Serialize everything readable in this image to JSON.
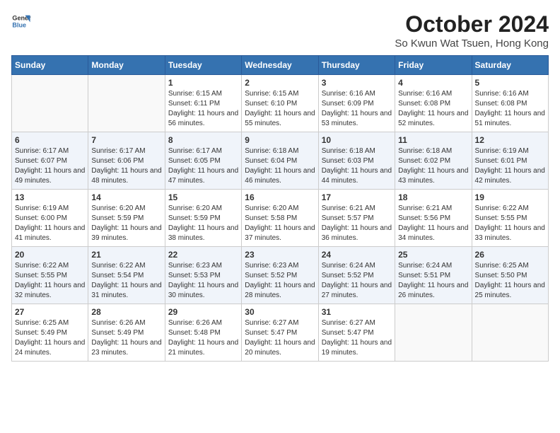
{
  "header": {
    "logo_line1": "General",
    "logo_line2": "Blue",
    "title": "October 2024",
    "subtitle": "So Kwun Wat Tsuen, Hong Kong"
  },
  "days_of_week": [
    "Sunday",
    "Monday",
    "Tuesday",
    "Wednesday",
    "Thursday",
    "Friday",
    "Saturday"
  ],
  "weeks": [
    [
      {
        "num": "",
        "detail": ""
      },
      {
        "num": "",
        "detail": ""
      },
      {
        "num": "1",
        "detail": "Sunrise: 6:15 AM\nSunset: 6:11 PM\nDaylight: 11 hours and 56 minutes."
      },
      {
        "num": "2",
        "detail": "Sunrise: 6:15 AM\nSunset: 6:10 PM\nDaylight: 11 hours and 55 minutes."
      },
      {
        "num": "3",
        "detail": "Sunrise: 6:16 AM\nSunset: 6:09 PM\nDaylight: 11 hours and 53 minutes."
      },
      {
        "num": "4",
        "detail": "Sunrise: 6:16 AM\nSunset: 6:08 PM\nDaylight: 11 hours and 52 minutes."
      },
      {
        "num": "5",
        "detail": "Sunrise: 6:16 AM\nSunset: 6:08 PM\nDaylight: 11 hours and 51 minutes."
      }
    ],
    [
      {
        "num": "6",
        "detail": "Sunrise: 6:17 AM\nSunset: 6:07 PM\nDaylight: 11 hours and 49 minutes."
      },
      {
        "num": "7",
        "detail": "Sunrise: 6:17 AM\nSunset: 6:06 PM\nDaylight: 11 hours and 48 minutes."
      },
      {
        "num": "8",
        "detail": "Sunrise: 6:17 AM\nSunset: 6:05 PM\nDaylight: 11 hours and 47 minutes."
      },
      {
        "num": "9",
        "detail": "Sunrise: 6:18 AM\nSunset: 6:04 PM\nDaylight: 11 hours and 46 minutes."
      },
      {
        "num": "10",
        "detail": "Sunrise: 6:18 AM\nSunset: 6:03 PM\nDaylight: 11 hours and 44 minutes."
      },
      {
        "num": "11",
        "detail": "Sunrise: 6:18 AM\nSunset: 6:02 PM\nDaylight: 11 hours and 43 minutes."
      },
      {
        "num": "12",
        "detail": "Sunrise: 6:19 AM\nSunset: 6:01 PM\nDaylight: 11 hours and 42 minutes."
      }
    ],
    [
      {
        "num": "13",
        "detail": "Sunrise: 6:19 AM\nSunset: 6:00 PM\nDaylight: 11 hours and 41 minutes."
      },
      {
        "num": "14",
        "detail": "Sunrise: 6:20 AM\nSunset: 5:59 PM\nDaylight: 11 hours and 39 minutes."
      },
      {
        "num": "15",
        "detail": "Sunrise: 6:20 AM\nSunset: 5:59 PM\nDaylight: 11 hours and 38 minutes."
      },
      {
        "num": "16",
        "detail": "Sunrise: 6:20 AM\nSunset: 5:58 PM\nDaylight: 11 hours and 37 minutes."
      },
      {
        "num": "17",
        "detail": "Sunrise: 6:21 AM\nSunset: 5:57 PM\nDaylight: 11 hours and 36 minutes."
      },
      {
        "num": "18",
        "detail": "Sunrise: 6:21 AM\nSunset: 5:56 PM\nDaylight: 11 hours and 34 minutes."
      },
      {
        "num": "19",
        "detail": "Sunrise: 6:22 AM\nSunset: 5:55 PM\nDaylight: 11 hours and 33 minutes."
      }
    ],
    [
      {
        "num": "20",
        "detail": "Sunrise: 6:22 AM\nSunset: 5:55 PM\nDaylight: 11 hours and 32 minutes."
      },
      {
        "num": "21",
        "detail": "Sunrise: 6:22 AM\nSunset: 5:54 PM\nDaylight: 11 hours and 31 minutes."
      },
      {
        "num": "22",
        "detail": "Sunrise: 6:23 AM\nSunset: 5:53 PM\nDaylight: 11 hours and 30 minutes."
      },
      {
        "num": "23",
        "detail": "Sunrise: 6:23 AM\nSunset: 5:52 PM\nDaylight: 11 hours and 28 minutes."
      },
      {
        "num": "24",
        "detail": "Sunrise: 6:24 AM\nSunset: 5:52 PM\nDaylight: 11 hours and 27 minutes."
      },
      {
        "num": "25",
        "detail": "Sunrise: 6:24 AM\nSunset: 5:51 PM\nDaylight: 11 hours and 26 minutes."
      },
      {
        "num": "26",
        "detail": "Sunrise: 6:25 AM\nSunset: 5:50 PM\nDaylight: 11 hours and 25 minutes."
      }
    ],
    [
      {
        "num": "27",
        "detail": "Sunrise: 6:25 AM\nSunset: 5:49 PM\nDaylight: 11 hours and 24 minutes."
      },
      {
        "num": "28",
        "detail": "Sunrise: 6:26 AM\nSunset: 5:49 PM\nDaylight: 11 hours and 23 minutes."
      },
      {
        "num": "29",
        "detail": "Sunrise: 6:26 AM\nSunset: 5:48 PM\nDaylight: 11 hours and 21 minutes."
      },
      {
        "num": "30",
        "detail": "Sunrise: 6:27 AM\nSunset: 5:47 PM\nDaylight: 11 hours and 20 minutes."
      },
      {
        "num": "31",
        "detail": "Sunrise: 6:27 AM\nSunset: 5:47 PM\nDaylight: 11 hours and 19 minutes."
      },
      {
        "num": "",
        "detail": ""
      },
      {
        "num": "",
        "detail": ""
      }
    ]
  ]
}
